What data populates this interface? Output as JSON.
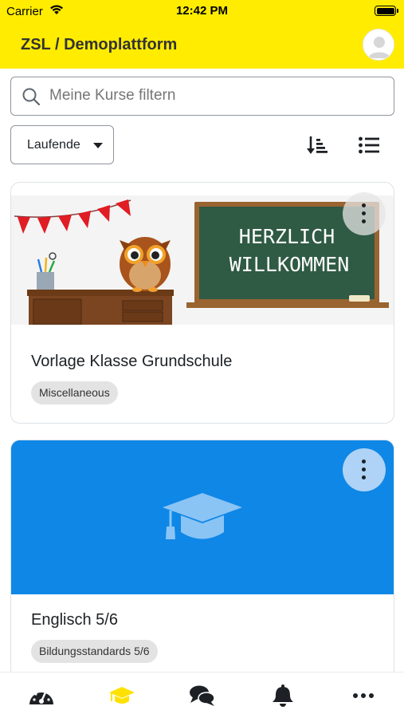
{
  "status_bar": {
    "carrier": "Carrier",
    "time": "12:42 PM"
  },
  "header": {
    "title": "ZSL / Demoplattform"
  },
  "search": {
    "placeholder": "Meine Kurse filtern"
  },
  "filter": {
    "selected": "Laufende"
  },
  "courses": [
    {
      "title": "Vorlage Klasse Grundschule",
      "category": "Miscellaneous",
      "image": {
        "chalkboard_line1": "HERZLICH",
        "chalkboard_line2": "WILLKOMMEN"
      }
    },
    {
      "title": "Englisch 5/6",
      "category": "Bildungsstandards 5/6",
      "image": {
        "icon": "graduation-cap-icon",
        "background": "#0f87e6"
      }
    }
  ],
  "tabs": [
    {
      "name": "dashboard",
      "icon": "dashboard-icon",
      "active": false
    },
    {
      "name": "my-courses",
      "icon": "graduation-cap-icon",
      "active": true
    },
    {
      "name": "messages",
      "icon": "comments-icon",
      "active": false
    },
    {
      "name": "notifications",
      "icon": "bell-icon",
      "active": false
    },
    {
      "name": "more",
      "icon": "more-icon",
      "active": false
    }
  ],
  "colors": {
    "brand": "#ffec00",
    "active_tab": "#ffe100",
    "card2_bg": "#0f87e6"
  }
}
